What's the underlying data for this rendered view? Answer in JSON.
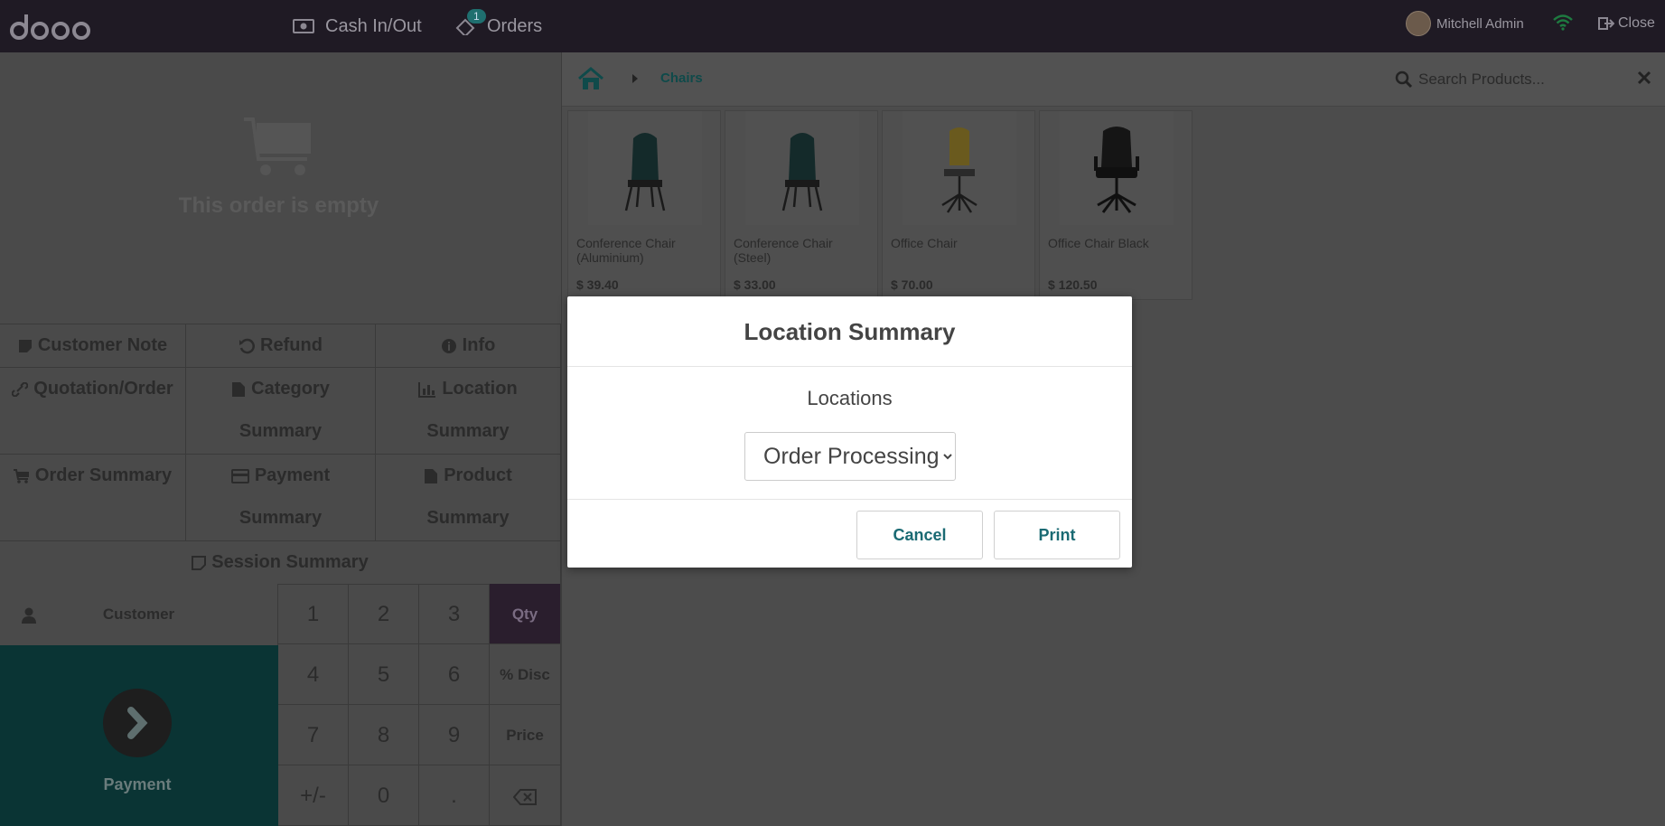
{
  "topbar": {
    "logo_text": "odoo",
    "cash_label": "Cash In/Out",
    "orders_label": "Orders",
    "orders_badge": "1",
    "user_name": "Mitchell Admin",
    "close_label": "Close"
  },
  "order": {
    "empty_text": "This order is empty"
  },
  "controls": {
    "customer_note": "Customer Note",
    "refund": "Refund",
    "info": "Info",
    "quotation_order": "Quotation/Order",
    "category_summary_1": "Category",
    "category_summary_2": "Summary",
    "location_summary_1": "Location",
    "location_summary_2": "Summary",
    "order_summary": "Order Summary",
    "payment_summary_1": "Payment",
    "payment_summary_2": "Summary",
    "product_summary_1": "Product",
    "product_summary_2": "Summary",
    "session_summary": "Session Summary"
  },
  "numpad": {
    "customer": "Customer",
    "payment": "Payment",
    "keys": [
      "1",
      "2",
      "3",
      "4",
      "5",
      "6",
      "7",
      "8",
      "9",
      "+/-",
      "0",
      "."
    ],
    "modes": [
      "Qty",
      "% Disc",
      "Price"
    ]
  },
  "breadcrumb": {
    "category": "Chairs"
  },
  "search": {
    "placeholder": "Search Products..."
  },
  "products": [
    {
      "name": "Conference Chair (Aluminium)",
      "price": "$ 39.40"
    },
    {
      "name": "Conference Chair (Steel)",
      "price": "$ 33.00"
    },
    {
      "name": "Office Chair",
      "price": "$ 70.00"
    },
    {
      "name": "Office Chair Black",
      "price": "$ 120.50"
    }
  ],
  "modal": {
    "title": "Location Summary",
    "label": "Locations",
    "selected_location": "Order Processing",
    "cancel": "Cancel",
    "print": "Print"
  }
}
